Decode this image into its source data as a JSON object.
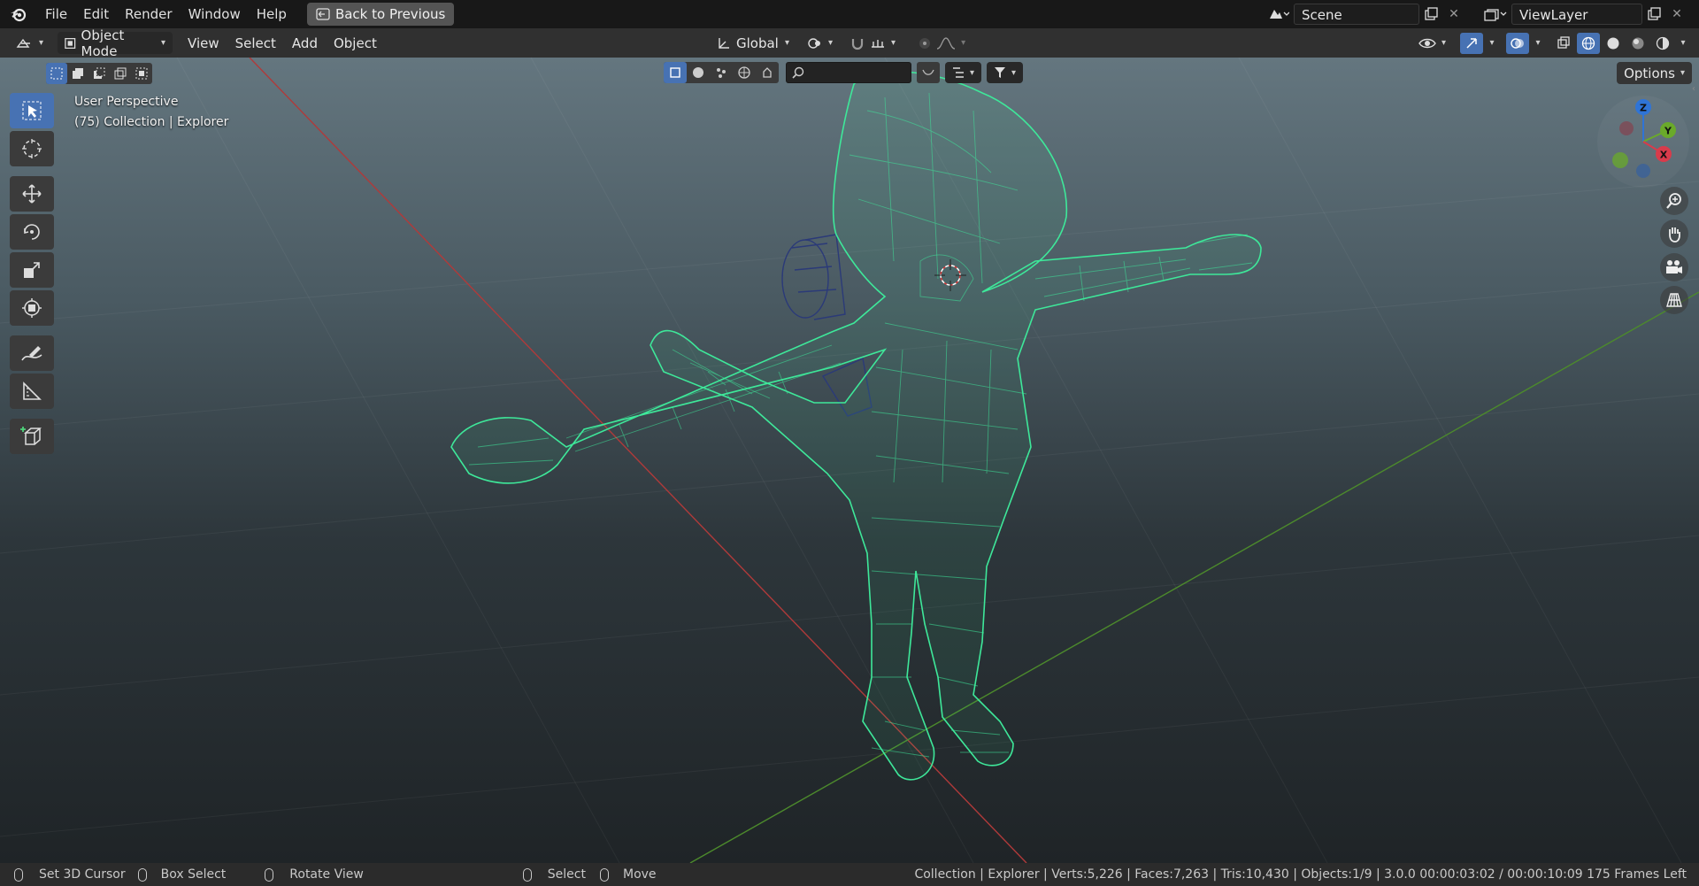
{
  "app": {
    "logo_icon": "blender-logo-icon"
  },
  "topbar": {
    "menus": [
      "File",
      "Edit",
      "Render",
      "Window",
      "Help"
    ],
    "back_button": "Back to Previous",
    "scene": "Scene",
    "view_layer": "ViewLayer"
  },
  "header": {
    "mode": "Object Mode",
    "menus": [
      "View",
      "Select",
      "Add",
      "Object"
    ],
    "orientation": "Global"
  },
  "viewport": {
    "view_name": "User Perspective",
    "collection_info": "(75) Collection | Explorer",
    "options_label": "Options",
    "search_placeholder": "",
    "gizmo": {
      "z": "Z",
      "y": "Y",
      "x": "X"
    },
    "wire_color": "#3ee89a",
    "axis_x_color": "#b03a3a",
    "axis_y_color": "#4c8a2c"
  },
  "toolbar": {
    "tools": [
      "select-box-icon",
      "cursor-icon",
      "move-icon",
      "rotate-icon",
      "scale-icon",
      "transform-icon",
      "annotate-icon",
      "measure-icon",
      "add-cube-icon"
    ]
  },
  "statusbar": {
    "items": [
      "Set 3D Cursor",
      "Box Select",
      "Rotate View",
      "Select",
      "Move"
    ],
    "stats": "Collection | Explorer | Verts:5,226 | Faces:7,263 | Tris:10,430 | Objects:1/9 | 3.0.0  00:00:03:02 / 00:00:10:09  175 Frames Left"
  }
}
